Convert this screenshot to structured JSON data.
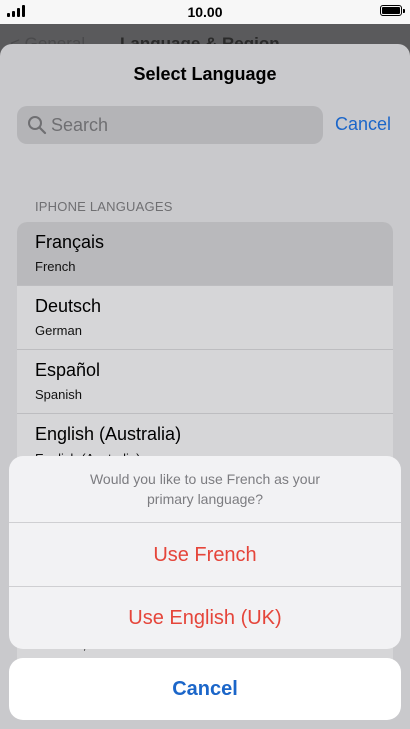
{
  "status_bar": {
    "time": "10.00",
    "signal_icon": "signal-bars-icon",
    "battery_icon": "battery-full-icon"
  },
  "background_nav": {
    "back_label": "< General",
    "title": "Language & Region"
  },
  "sheet": {
    "title": "Select Language",
    "search": {
      "placeholder": "Search",
      "value": "",
      "icon": "search-icon"
    },
    "search_cancel": "Cancel",
    "section_header": "IPHONE LANGUAGES",
    "languages": [
      {
        "name": "Français",
        "sub": "French",
        "selected": true
      },
      {
        "name": "Deutsch",
        "sub": "German",
        "selected": false
      },
      {
        "name": "Español",
        "sub": "Spanish",
        "selected": false
      },
      {
        "name": "English (Australia)",
        "sub": "English (Australia)",
        "selected": false
      }
    ],
    "peek_text": "Chinese, Traditional"
  },
  "action_sheet": {
    "message": "Would you like to use French as your primary language?",
    "use_french": "Use French",
    "use_english": "Use English (UK)",
    "cancel": "Cancel"
  },
  "colors": {
    "accent_blue": "#1b66c9",
    "destructive_red": "#e5453a"
  }
}
